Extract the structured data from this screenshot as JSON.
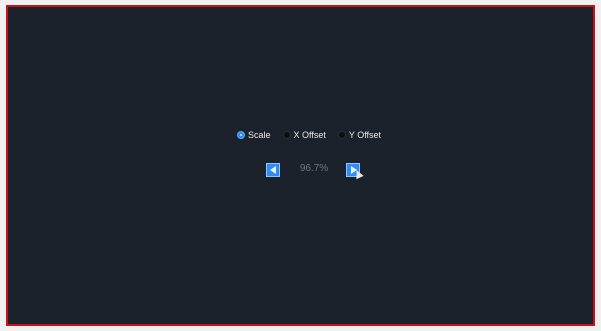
{
  "options": {
    "scale_label": "Scale",
    "x_offset_label": "X Offset",
    "y_offset_label": "Y Offset",
    "selected": "Scale"
  },
  "controls": {
    "value_text": "96.7%"
  },
  "colors": {
    "accent": "#2f8df2",
    "border": "#c8121a",
    "background": "#1c222b"
  }
}
